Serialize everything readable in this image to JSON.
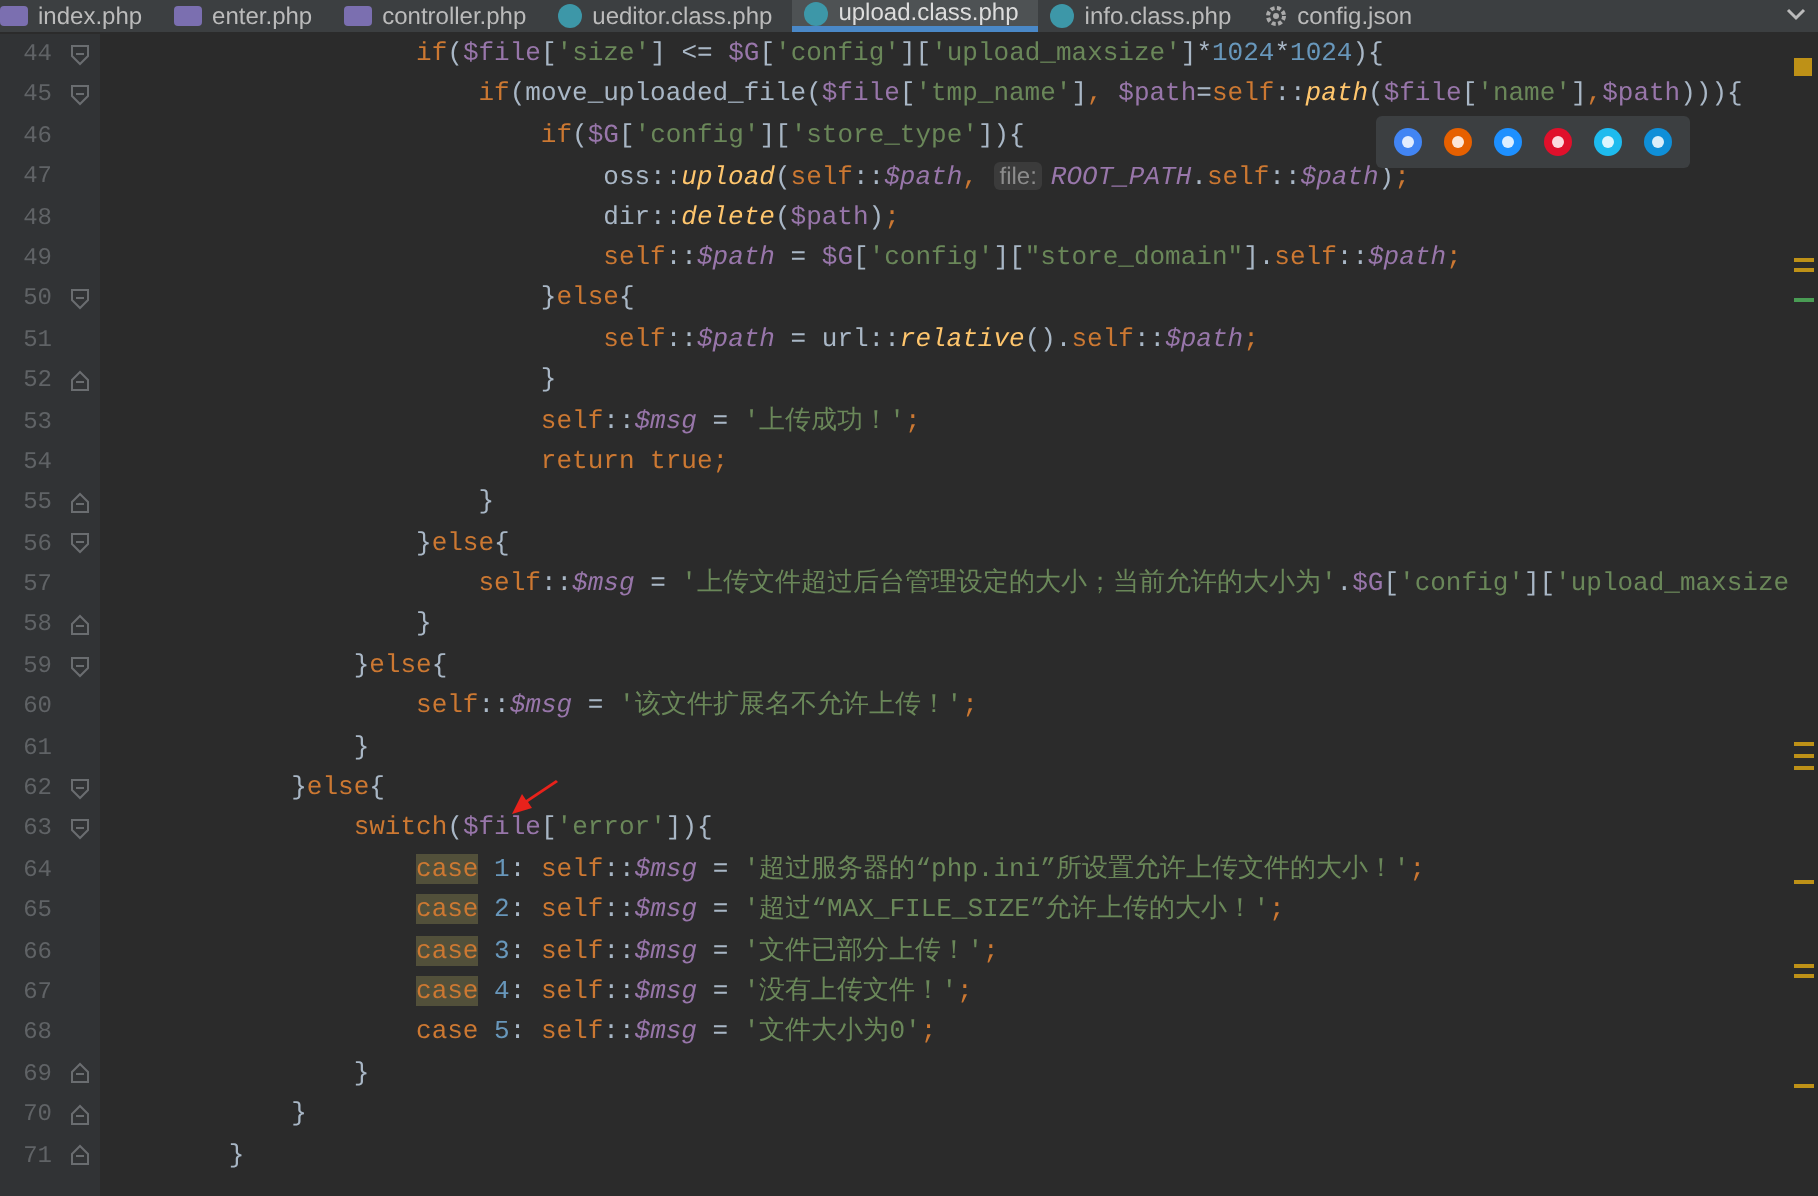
{
  "tabs": [
    {
      "label": "index.php",
      "kind": "php",
      "selected": false
    },
    {
      "label": "enter.php",
      "kind": "php",
      "selected": false
    },
    {
      "label": "controller.php",
      "kind": "php",
      "selected": false
    },
    {
      "label": "ueditor.class.php",
      "kind": "class",
      "selected": false
    },
    {
      "label": "upload.class.php",
      "kind": "class",
      "selected": true
    },
    {
      "label": "info.class.php",
      "kind": "class",
      "selected": false
    },
    {
      "label": "config.json",
      "kind": "json",
      "selected": false
    }
  ],
  "editor": {
    "lines": [
      {
        "number": "44",
        "kind": "fold-start",
        "tokens": [
          {
            "kind": "kw",
            "text": "                    if"
          },
          {
            "kind": "plain",
            "text": "("
          },
          {
            "kind": "var",
            "text": "$file"
          },
          {
            "kind": "plain",
            "text": "["
          },
          {
            "kind": "str",
            "text": "'size'"
          },
          {
            "kind": "plain",
            "text": "] <= "
          },
          {
            "kind": "var",
            "text": "$G"
          },
          {
            "kind": "plain",
            "text": "["
          },
          {
            "kind": "str",
            "text": "'config'"
          },
          {
            "kind": "plain",
            "text": "]["
          },
          {
            "kind": "str",
            "text": "'upload_maxsize'"
          },
          {
            "kind": "plain",
            "text": "]*"
          },
          {
            "kind": "num",
            "text": "1024"
          },
          {
            "kind": "plain",
            "text": "*"
          },
          {
            "kind": "num",
            "text": "1024"
          },
          {
            "kind": "plain",
            "text": "){"
          }
        ]
      },
      {
        "number": "45",
        "kind": "fold-start",
        "tokens": [
          {
            "kind": "kw",
            "text": "                        if"
          },
          {
            "kind": "plain",
            "text": "(move_uploaded_file("
          },
          {
            "kind": "var",
            "text": "$file"
          },
          {
            "kind": "plain",
            "text": "["
          },
          {
            "kind": "str",
            "text": "'tmp_name'"
          },
          {
            "kind": "plain",
            "text": "]"
          },
          {
            "kind": "kw",
            "text": ", "
          },
          {
            "kind": "var",
            "text": "$path"
          },
          {
            "kind": "plain",
            "text": "="
          },
          {
            "kind": "kw",
            "text": "self"
          },
          {
            "kind": "plain",
            "text": "::"
          },
          {
            "kind": "fn",
            "text": "path"
          },
          {
            "kind": "plain",
            "text": "("
          },
          {
            "kind": "var",
            "text": "$file"
          },
          {
            "kind": "plain",
            "text": "["
          },
          {
            "kind": "str",
            "text": "'name'"
          },
          {
            "kind": "plain",
            "text": "]"
          },
          {
            "kind": "kw",
            "text": ","
          },
          {
            "kind": "var",
            "text": "$path"
          },
          {
            "kind": "plain",
            "text": "))){"
          }
        ]
      },
      {
        "number": "46",
        "kind": "plain",
        "tokens": [
          {
            "kind": "kw",
            "text": "                            if"
          },
          {
            "kind": "plain",
            "text": "("
          },
          {
            "kind": "var",
            "text": "$G"
          },
          {
            "kind": "plain",
            "text": "["
          },
          {
            "kind": "str",
            "text": "'config'"
          },
          {
            "kind": "plain",
            "text": "]["
          },
          {
            "kind": "str",
            "text": "'store_type'"
          },
          {
            "kind": "plain",
            "text": "]){"
          }
        ]
      },
      {
        "number": "47",
        "kind": "plain",
        "tokens": [
          {
            "kind": "plain",
            "text": "                                oss::"
          },
          {
            "kind": "fn",
            "text": "upload"
          },
          {
            "kind": "plain",
            "text": "("
          },
          {
            "kind": "kw",
            "text": "self"
          },
          {
            "kind": "plain",
            "text": "::"
          },
          {
            "kind": "field",
            "text": "$path"
          },
          {
            "kind": "kw",
            "text": ", "
          },
          {
            "kind": "hint",
            "text": "file:"
          },
          {
            "kind": "field",
            "text": "ROOT_PATH"
          },
          {
            "kind": "plain",
            "text": "."
          },
          {
            "kind": "kw",
            "text": "self"
          },
          {
            "kind": "plain",
            "text": "::"
          },
          {
            "kind": "field",
            "text": "$path"
          },
          {
            "kind": "plain",
            "text": ")"
          },
          {
            "kind": "kw",
            "text": ";"
          }
        ]
      },
      {
        "number": "48",
        "kind": "plain",
        "tokens": [
          {
            "kind": "plain",
            "text": "                                dir::"
          },
          {
            "kind": "fn",
            "text": "delete"
          },
          {
            "kind": "plain",
            "text": "("
          },
          {
            "kind": "var",
            "text": "$path"
          },
          {
            "kind": "plain",
            "text": ")"
          },
          {
            "kind": "kw",
            "text": ";"
          }
        ]
      },
      {
        "number": "49",
        "kind": "plain",
        "tokens": [
          {
            "kind": "kw",
            "text": "                                self"
          },
          {
            "kind": "plain",
            "text": "::"
          },
          {
            "kind": "field",
            "text": "$path"
          },
          {
            "kind": "plain",
            "text": " = "
          },
          {
            "kind": "var",
            "text": "$G"
          },
          {
            "kind": "plain",
            "text": "["
          },
          {
            "kind": "str",
            "text": "'config'"
          },
          {
            "kind": "plain",
            "text": "]["
          },
          {
            "kind": "str",
            "text": "\"store_domain\""
          },
          {
            "kind": "plain",
            "text": "]."
          },
          {
            "kind": "kw",
            "text": "self"
          },
          {
            "kind": "plain",
            "text": "::"
          },
          {
            "kind": "field",
            "text": "$path"
          },
          {
            "kind": "kw",
            "text": ";"
          }
        ]
      },
      {
        "number": "50",
        "kind": "fold-start",
        "tokens": [
          {
            "kind": "plain",
            "text": "                            }"
          },
          {
            "kind": "kw",
            "text": "else"
          },
          {
            "kind": "plain",
            "text": "{"
          }
        ]
      },
      {
        "number": "51",
        "kind": "plain",
        "tokens": [
          {
            "kind": "kw",
            "text": "                                self"
          },
          {
            "kind": "plain",
            "text": "::"
          },
          {
            "kind": "field",
            "text": "$path"
          },
          {
            "kind": "plain",
            "text": " = url::"
          },
          {
            "kind": "fn",
            "text": "relative"
          },
          {
            "kind": "plain",
            "text": "()."
          },
          {
            "kind": "kw",
            "text": "self"
          },
          {
            "kind": "plain",
            "text": "::"
          },
          {
            "kind": "field",
            "text": "$path"
          },
          {
            "kind": "kw",
            "text": ";"
          }
        ]
      },
      {
        "number": "52",
        "kind": "fold-end",
        "tokens": [
          {
            "kind": "plain",
            "text": "                            }"
          }
        ]
      },
      {
        "number": "53",
        "kind": "plain",
        "tokens": [
          {
            "kind": "kw",
            "text": "                            self"
          },
          {
            "kind": "plain",
            "text": "::"
          },
          {
            "kind": "field",
            "text": "$msg"
          },
          {
            "kind": "plain",
            "text": " = "
          },
          {
            "kind": "str",
            "text": "'上传成功！'"
          },
          {
            "kind": "kw",
            "text": ";"
          }
        ]
      },
      {
        "number": "54",
        "kind": "plain",
        "tokens": [
          {
            "kind": "kw",
            "text": "                            return true;"
          }
        ]
      },
      {
        "number": "55",
        "kind": "fold-end",
        "tokens": [
          {
            "kind": "plain",
            "text": "                        }"
          }
        ]
      },
      {
        "number": "56",
        "kind": "fold-start",
        "tokens": [
          {
            "kind": "plain",
            "text": "                    }"
          },
          {
            "kind": "kw",
            "text": "else"
          },
          {
            "kind": "plain",
            "text": "{"
          }
        ]
      },
      {
        "number": "57",
        "kind": "plain",
        "tokens": [
          {
            "kind": "kw",
            "text": "                        self"
          },
          {
            "kind": "plain",
            "text": "::"
          },
          {
            "kind": "field",
            "text": "$msg"
          },
          {
            "kind": "plain",
            "text": " = "
          },
          {
            "kind": "str",
            "text": "'上传文件超过后台管理设定的大小；当前允许的大小为'"
          },
          {
            "kind": "plain",
            "text": "."
          },
          {
            "kind": "var",
            "text": "$G"
          },
          {
            "kind": "plain",
            "text": "["
          },
          {
            "kind": "str",
            "text": "'config'"
          },
          {
            "kind": "plain",
            "text": "]["
          },
          {
            "kind": "str",
            "text": "'upload_maxsize"
          }
        ]
      },
      {
        "number": "58",
        "kind": "fold-end",
        "tokens": [
          {
            "kind": "plain",
            "text": "                    }"
          }
        ]
      },
      {
        "number": "59",
        "kind": "fold-start",
        "tokens": [
          {
            "kind": "plain",
            "text": "                }"
          },
          {
            "kind": "kw",
            "text": "else"
          },
          {
            "kind": "plain",
            "text": "{"
          }
        ]
      },
      {
        "number": "60",
        "kind": "plain",
        "tokens": [
          {
            "kind": "kw",
            "text": "                    self"
          },
          {
            "kind": "plain",
            "text": "::"
          },
          {
            "kind": "field",
            "text": "$msg"
          },
          {
            "kind": "plain",
            "text": " = "
          },
          {
            "kind": "str",
            "text": "'该文件扩展名不允许上传！'"
          },
          {
            "kind": "kw",
            "text": ";"
          }
        ]
      },
      {
        "number": "61",
        "kind": "plain",
        "tokens": [
          {
            "kind": "plain",
            "text": "                }"
          }
        ]
      },
      {
        "number": "62",
        "kind": "fold-start",
        "tokens": [
          {
            "kind": "plain",
            "text": "            }"
          },
          {
            "kind": "kw",
            "text": "else"
          },
          {
            "kind": "plain",
            "text": "{"
          }
        ]
      },
      {
        "number": "63",
        "kind": "fold-start",
        "tokens": [
          {
            "kind": "kw",
            "text": "                switch"
          },
          {
            "kind": "plain",
            "text": "("
          },
          {
            "kind": "var",
            "text": "$file"
          },
          {
            "kind": "plain",
            "text": "["
          },
          {
            "kind": "str",
            "text": "'error'"
          },
          {
            "kind": "plain",
            "text": "]){"
          }
        ]
      },
      {
        "number": "64",
        "kind": "plain",
        "tokens": [
          {
            "kind": "match",
            "text": "                    case"
          },
          {
            "kind": "num",
            "text": " 1"
          },
          {
            "kind": "plain",
            "text": ": "
          },
          {
            "kind": "kw",
            "text": "self"
          },
          {
            "kind": "plain",
            "text": "::"
          },
          {
            "kind": "field",
            "text": "$msg"
          },
          {
            "kind": "plain",
            "text": " = "
          },
          {
            "kind": "str",
            "text": "'超过服务器的“php.ini”所设置允许上传文件的大小！'"
          },
          {
            "kind": "kw",
            "text": ";"
          }
        ]
      },
      {
        "number": "65",
        "kind": "plain",
        "tokens": [
          {
            "kind": "match",
            "text": "                    case"
          },
          {
            "kind": "num",
            "text": " 2"
          },
          {
            "kind": "plain",
            "text": ": "
          },
          {
            "kind": "kw",
            "text": "self"
          },
          {
            "kind": "plain",
            "text": "::"
          },
          {
            "kind": "field",
            "text": "$msg"
          },
          {
            "kind": "plain",
            "text": " = "
          },
          {
            "kind": "str",
            "text": "'超过“MAX_FILE_SIZE”允许上传的大小！'"
          },
          {
            "kind": "kw",
            "text": ";"
          }
        ]
      },
      {
        "number": "66",
        "kind": "plain",
        "tokens": [
          {
            "kind": "match",
            "text": "                    case"
          },
          {
            "kind": "num",
            "text": " 3"
          },
          {
            "kind": "plain",
            "text": ": "
          },
          {
            "kind": "kw",
            "text": "self"
          },
          {
            "kind": "plain",
            "text": "::"
          },
          {
            "kind": "field",
            "text": "$msg"
          },
          {
            "kind": "plain",
            "text": " = "
          },
          {
            "kind": "str",
            "text": "'文件已部分上传！'"
          },
          {
            "kind": "kw",
            "text": ";"
          }
        ]
      },
      {
        "number": "67",
        "kind": "plain",
        "tokens": [
          {
            "kind": "match",
            "text": "                    case"
          },
          {
            "kind": "num",
            "text": " 4"
          },
          {
            "kind": "plain",
            "text": ": "
          },
          {
            "kind": "kw",
            "text": "self"
          },
          {
            "kind": "plain",
            "text": "::"
          },
          {
            "kind": "field",
            "text": "$msg"
          },
          {
            "kind": "plain",
            "text": " = "
          },
          {
            "kind": "str",
            "text": "'没有上传文件！'"
          },
          {
            "kind": "kw",
            "text": ";"
          }
        ]
      },
      {
        "number": "68",
        "kind": "plain",
        "tokens": [
          {
            "kind": "kw",
            "text": "                    case"
          },
          {
            "kind": "num",
            "text": " 5"
          },
          {
            "kind": "plain",
            "text": ": "
          },
          {
            "kind": "kw",
            "text": "self"
          },
          {
            "kind": "plain",
            "text": "::"
          },
          {
            "kind": "field",
            "text": "$msg"
          },
          {
            "kind": "plain",
            "text": " = "
          },
          {
            "kind": "str",
            "text": "'文件大小为0'"
          },
          {
            "kind": "kw",
            "text": ";"
          }
        ]
      },
      {
        "number": "69",
        "kind": "fold-end",
        "tokens": [
          {
            "kind": "plain",
            "text": "                }"
          }
        ]
      },
      {
        "number": "70",
        "kind": "fold-end",
        "tokens": [
          {
            "kind": "plain",
            "text": "            }"
          }
        ]
      },
      {
        "number": "71",
        "kind": "fold-end",
        "tokens": [
          {
            "kind": "plain",
            "text": "        }"
          }
        ]
      }
    ]
  }
}
